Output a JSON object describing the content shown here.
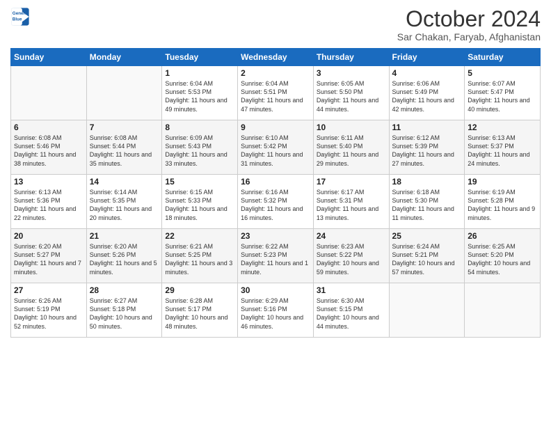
{
  "logo": {
    "line1": "General",
    "line2": "Blue"
  },
  "title": "October 2024",
  "location": "Sar Chakan, Faryab, Afghanistan",
  "weekdays": [
    "Sunday",
    "Monday",
    "Tuesday",
    "Wednesday",
    "Thursday",
    "Friday",
    "Saturday"
  ],
  "weeks": [
    [
      {
        "day": "",
        "info": ""
      },
      {
        "day": "",
        "info": ""
      },
      {
        "day": "1",
        "info": "Sunrise: 6:04 AM\nSunset: 5:53 PM\nDaylight: 11 hours and 49 minutes."
      },
      {
        "day": "2",
        "info": "Sunrise: 6:04 AM\nSunset: 5:51 PM\nDaylight: 11 hours and 47 minutes."
      },
      {
        "day": "3",
        "info": "Sunrise: 6:05 AM\nSunset: 5:50 PM\nDaylight: 11 hours and 44 minutes."
      },
      {
        "day": "4",
        "info": "Sunrise: 6:06 AM\nSunset: 5:49 PM\nDaylight: 11 hours and 42 minutes."
      },
      {
        "day": "5",
        "info": "Sunrise: 6:07 AM\nSunset: 5:47 PM\nDaylight: 11 hours and 40 minutes."
      }
    ],
    [
      {
        "day": "6",
        "info": "Sunrise: 6:08 AM\nSunset: 5:46 PM\nDaylight: 11 hours and 38 minutes."
      },
      {
        "day": "7",
        "info": "Sunrise: 6:08 AM\nSunset: 5:44 PM\nDaylight: 11 hours and 35 minutes."
      },
      {
        "day": "8",
        "info": "Sunrise: 6:09 AM\nSunset: 5:43 PM\nDaylight: 11 hours and 33 minutes."
      },
      {
        "day": "9",
        "info": "Sunrise: 6:10 AM\nSunset: 5:42 PM\nDaylight: 11 hours and 31 minutes."
      },
      {
        "day": "10",
        "info": "Sunrise: 6:11 AM\nSunset: 5:40 PM\nDaylight: 11 hours and 29 minutes."
      },
      {
        "day": "11",
        "info": "Sunrise: 6:12 AM\nSunset: 5:39 PM\nDaylight: 11 hours and 27 minutes."
      },
      {
        "day": "12",
        "info": "Sunrise: 6:13 AM\nSunset: 5:37 PM\nDaylight: 11 hours and 24 minutes."
      }
    ],
    [
      {
        "day": "13",
        "info": "Sunrise: 6:13 AM\nSunset: 5:36 PM\nDaylight: 11 hours and 22 minutes."
      },
      {
        "day": "14",
        "info": "Sunrise: 6:14 AM\nSunset: 5:35 PM\nDaylight: 11 hours and 20 minutes."
      },
      {
        "day": "15",
        "info": "Sunrise: 6:15 AM\nSunset: 5:33 PM\nDaylight: 11 hours and 18 minutes."
      },
      {
        "day": "16",
        "info": "Sunrise: 6:16 AM\nSunset: 5:32 PM\nDaylight: 11 hours and 16 minutes."
      },
      {
        "day": "17",
        "info": "Sunrise: 6:17 AM\nSunset: 5:31 PM\nDaylight: 11 hours and 13 minutes."
      },
      {
        "day": "18",
        "info": "Sunrise: 6:18 AM\nSunset: 5:30 PM\nDaylight: 11 hours and 11 minutes."
      },
      {
        "day": "19",
        "info": "Sunrise: 6:19 AM\nSunset: 5:28 PM\nDaylight: 11 hours and 9 minutes."
      }
    ],
    [
      {
        "day": "20",
        "info": "Sunrise: 6:20 AM\nSunset: 5:27 PM\nDaylight: 11 hours and 7 minutes."
      },
      {
        "day": "21",
        "info": "Sunrise: 6:20 AM\nSunset: 5:26 PM\nDaylight: 11 hours and 5 minutes."
      },
      {
        "day": "22",
        "info": "Sunrise: 6:21 AM\nSunset: 5:25 PM\nDaylight: 11 hours and 3 minutes."
      },
      {
        "day": "23",
        "info": "Sunrise: 6:22 AM\nSunset: 5:23 PM\nDaylight: 11 hours and 1 minute."
      },
      {
        "day": "24",
        "info": "Sunrise: 6:23 AM\nSunset: 5:22 PM\nDaylight: 10 hours and 59 minutes."
      },
      {
        "day": "25",
        "info": "Sunrise: 6:24 AM\nSunset: 5:21 PM\nDaylight: 10 hours and 57 minutes."
      },
      {
        "day": "26",
        "info": "Sunrise: 6:25 AM\nSunset: 5:20 PM\nDaylight: 10 hours and 54 minutes."
      }
    ],
    [
      {
        "day": "27",
        "info": "Sunrise: 6:26 AM\nSunset: 5:19 PM\nDaylight: 10 hours and 52 minutes."
      },
      {
        "day": "28",
        "info": "Sunrise: 6:27 AM\nSunset: 5:18 PM\nDaylight: 10 hours and 50 minutes."
      },
      {
        "day": "29",
        "info": "Sunrise: 6:28 AM\nSunset: 5:17 PM\nDaylight: 10 hours and 48 minutes."
      },
      {
        "day": "30",
        "info": "Sunrise: 6:29 AM\nSunset: 5:16 PM\nDaylight: 10 hours and 46 minutes."
      },
      {
        "day": "31",
        "info": "Sunrise: 6:30 AM\nSunset: 5:15 PM\nDaylight: 10 hours and 44 minutes."
      },
      {
        "day": "",
        "info": ""
      },
      {
        "day": "",
        "info": ""
      }
    ]
  ]
}
